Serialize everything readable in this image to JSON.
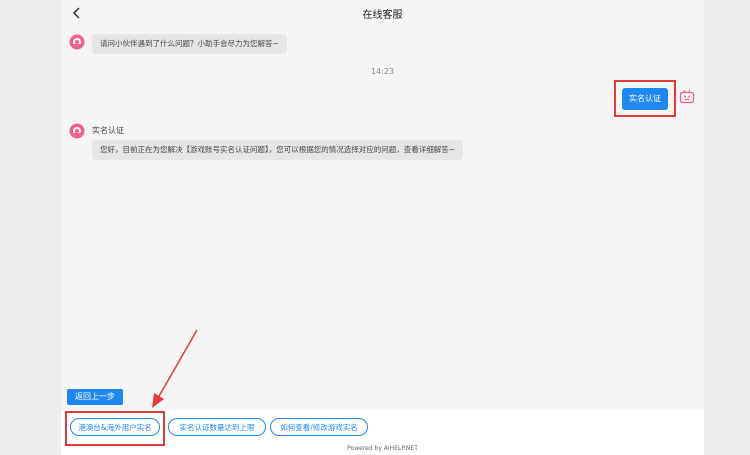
{
  "header": {
    "title": "在线客服"
  },
  "messages": {
    "greeting": "请问小伙伴遇到了什么问题？小助手会尽力为您解答~",
    "time": "14:23",
    "user_choice": "实名认证",
    "bot_sender": "实名认证",
    "bot_reply": "您好，目前正在为您解决【游戏账号实名认证问题】，您可以根据您的情况选择对应的问题，查看详细解答~"
  },
  "actions": {
    "back_step": "返回上一步"
  },
  "quick_replies": [
    {
      "label": "港澳台&海外用户实名"
    },
    {
      "label": "实名认证数量达到上限"
    },
    {
      "label": "如何查看/修改游戏实名"
    }
  ],
  "footer": {
    "powered_by": "Powered by AIHELP.NET"
  },
  "colors": {
    "accent": "#1e88f0",
    "highlight": "#e23b3b",
    "avatar": "#f0608a"
  },
  "icons": [
    "back-icon",
    "assistant-avatar-icon",
    "bot-icon"
  ]
}
